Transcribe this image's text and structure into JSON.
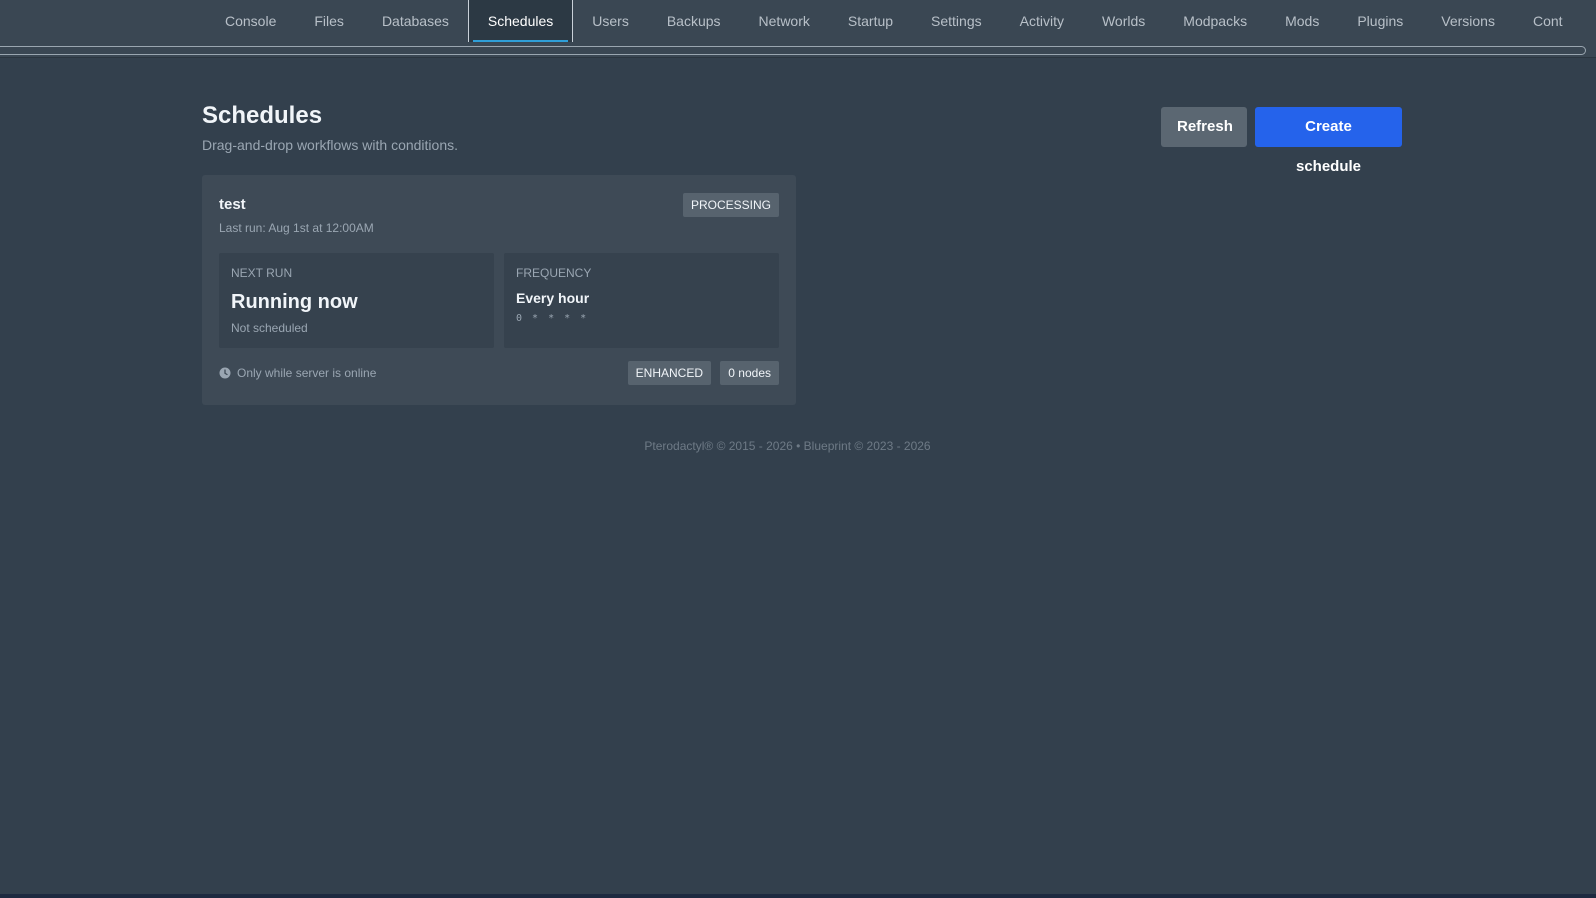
{
  "nav": {
    "tabs": [
      {
        "label": "Console"
      },
      {
        "label": "Files"
      },
      {
        "label": "Databases"
      },
      {
        "label": "Schedules",
        "active": true
      },
      {
        "label": "Users"
      },
      {
        "label": "Backups"
      },
      {
        "label": "Network"
      },
      {
        "label": "Startup"
      },
      {
        "label": "Settings"
      },
      {
        "label": "Activity"
      },
      {
        "label": "Worlds"
      },
      {
        "label": "Modpacks"
      },
      {
        "label": "Mods"
      },
      {
        "label": "Plugins"
      },
      {
        "label": "Versions"
      },
      {
        "label": "Cont"
      }
    ]
  },
  "header": {
    "title": "Schedules",
    "subtitle": "Drag-and-drop workflows with conditions.",
    "refresh_label": "Refresh",
    "create_label": "Create schedule"
  },
  "schedule": {
    "name": "test",
    "last_run": "Last run: Aug 1st at 12:00AM",
    "status": "PROCESSING",
    "next_run_label": "NEXT RUN",
    "next_run_value": "Running now",
    "next_run_sub": "Not scheduled",
    "frequency_label": "FREQUENCY",
    "frequency_value": "Every hour",
    "frequency_cron": "0 * * * *",
    "condition": "Only while server is online",
    "mode_badge": "ENHANCED",
    "nodes_badge": "0 nodes",
    "icons": {
      "condition": "clock-icon"
    }
  },
  "footer": {
    "text": "Pterodactyl® © 2015 - 2026  •  Blueprint © 2023 - 2026"
  },
  "colors": {
    "background": "#33404d",
    "accent": "#2563eb",
    "active_tab_underline": "#2f9fd8"
  }
}
